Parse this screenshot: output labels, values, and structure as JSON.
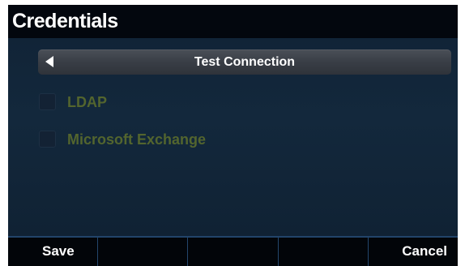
{
  "header": {
    "title": "Credentials"
  },
  "main": {
    "test_connection_label": "Test Connection",
    "options": [
      {
        "label": "LDAP",
        "checked": false
      },
      {
        "label": "Microsoft Exchange",
        "checked": false
      }
    ]
  },
  "softkeys": [
    "Save",
    "",
    "",
    "",
    "Cancel"
  ],
  "colors": {
    "background": "#0d1a2c",
    "title_bar": "#03070e",
    "disabled_option_text": "#53652e",
    "softkey_divider": "#23466c"
  }
}
